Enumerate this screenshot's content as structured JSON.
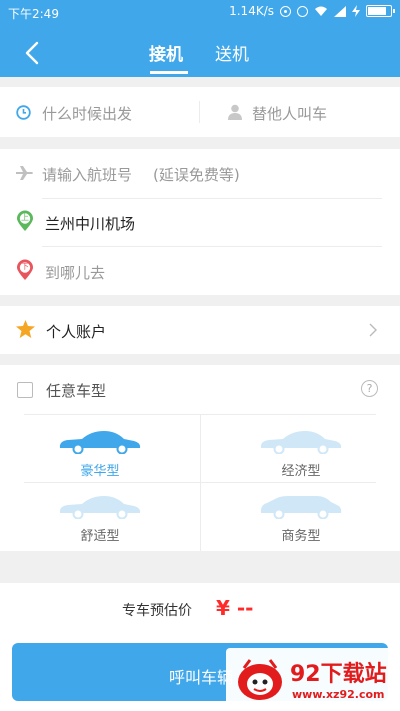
{
  "status_bar": {
    "time": "下午2:49",
    "network_speed": "1.14K/s"
  },
  "header": {
    "tabs": [
      {
        "label": "接机",
        "active": true
      },
      {
        "label": "送机",
        "active": false
      }
    ]
  },
  "trip": {
    "departure_time_placeholder": "什么时候出发",
    "call_for_other": "替他人叫车",
    "flight_placeholder": "请输入航班号",
    "flight_hint": "(延误免费等)",
    "pickup_label": "上",
    "pickup_location": "兰州中川机场",
    "dropoff_label": "下",
    "dropoff_placeholder": "到哪儿去"
  },
  "account": {
    "label": "个人账户"
  },
  "car_type": {
    "any_label": "任意车型",
    "options": [
      {
        "label": "豪华型",
        "selected": true
      },
      {
        "label": "经济型",
        "selected": false
      },
      {
        "label": "舒适型",
        "selected": false
      },
      {
        "label": "商务型",
        "selected": false
      }
    ]
  },
  "estimate": {
    "label": "专车预估价",
    "price": "¥ --"
  },
  "call_button": {
    "label": "呼叫车辆"
  },
  "watermark": {
    "brand": "92下载站",
    "url": "www.xz92.com"
  },
  "colors": {
    "accent": "#3fa7ea",
    "selected_car": "#3fa7ea",
    "unselected_car": "#cfe7f6",
    "price": "#ff2a2a",
    "pickup_green": "#5cb85c",
    "dropoff_red": "#e8555c",
    "star": "#f5a623"
  }
}
